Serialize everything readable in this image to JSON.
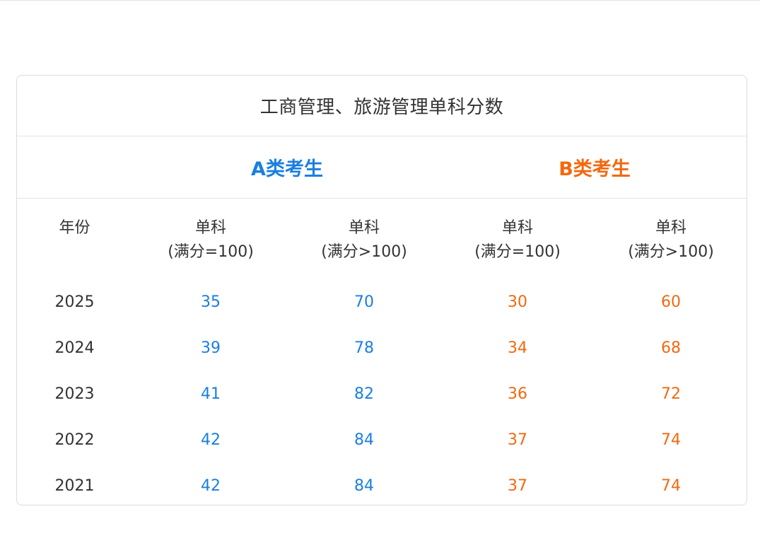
{
  "table": {
    "title": "工商管理、旅游管理单科分数",
    "groups": {
      "a": {
        "label": "A类考生",
        "color": "#1a7fe0"
      },
      "b": {
        "label": "B类考生",
        "color": "#f2690f"
      }
    },
    "headers": {
      "year": "年份",
      "a_eq": {
        "line1": "单科",
        "line2": "(满分=100)"
      },
      "a_gt": {
        "line1": "单科",
        "line2": "(满分>100)"
      },
      "b_eq": {
        "line1": "单科",
        "line2": "(满分=100)"
      },
      "b_gt": {
        "line1": "单科",
        "line2": "(满分>100)"
      }
    },
    "rows": [
      {
        "year": "2025",
        "a_eq": "35",
        "a_gt": "70",
        "b_eq": "30",
        "b_gt": "60"
      },
      {
        "year": "2024",
        "a_eq": "39",
        "a_gt": "78",
        "b_eq": "34",
        "b_gt": "68"
      },
      {
        "year": "2023",
        "a_eq": "41",
        "a_gt": "82",
        "b_eq": "36",
        "b_gt": "72"
      },
      {
        "year": "2022",
        "a_eq": "42",
        "a_gt": "84",
        "b_eq": "37",
        "b_gt": "74"
      },
      {
        "year": "2021",
        "a_eq": "42",
        "a_gt": "84",
        "b_eq": "37",
        "b_gt": "74"
      }
    ]
  }
}
